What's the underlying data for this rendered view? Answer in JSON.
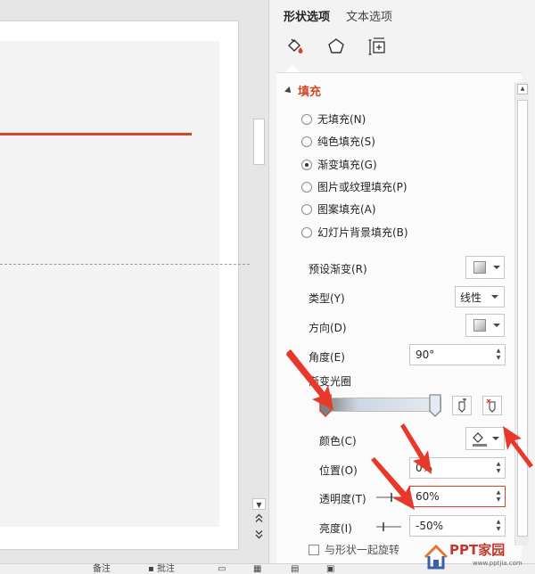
{
  "pane": {
    "tabs": [
      {
        "label": "形状选项",
        "active": true
      },
      {
        "label": "文本选项",
        "active": false
      }
    ],
    "category_icons": [
      "fill-line-icon",
      "effects-pentagon-icon",
      "size-properties-icon"
    ],
    "fill_section": {
      "title": "填充",
      "options": [
        {
          "label": "无填充(N)",
          "checked": false
        },
        {
          "label": "纯色填充(S)",
          "checked": false
        },
        {
          "label": "渐变填充(G)",
          "checked": true
        },
        {
          "label": "图片或纹理填充(P)",
          "checked": false
        },
        {
          "label": "图案填充(A)",
          "checked": false
        },
        {
          "label": "幻灯片背景填充(B)",
          "checked": false
        }
      ],
      "preset_gradient": {
        "label": "预设渐变(R)"
      },
      "type": {
        "label": "类型(Y)",
        "value": "线性"
      },
      "direction": {
        "label": "方向(D)"
      },
      "angle": {
        "label": "角度(E)",
        "value": "90°"
      },
      "gradient_stops": {
        "label": "渐变光圈"
      },
      "color": {
        "label": "颜色(C)"
      },
      "position": {
        "label": "位置(O)",
        "value": "0%"
      },
      "transparency": {
        "label": "透明度(T)",
        "value": "60%"
      },
      "brightness": {
        "label": "亮度(I)",
        "value": "-50%"
      },
      "rotate_with_shape": {
        "label": "与形状一起旋转"
      }
    }
  },
  "statusbar": {
    "notes": "备注",
    "comments": "批注"
  },
  "watermark": {
    "brand": "PPT家园",
    "url": "www.pptjia.com"
  },
  "colors": {
    "accent": "#d24726",
    "annotation": "#e8382c"
  }
}
